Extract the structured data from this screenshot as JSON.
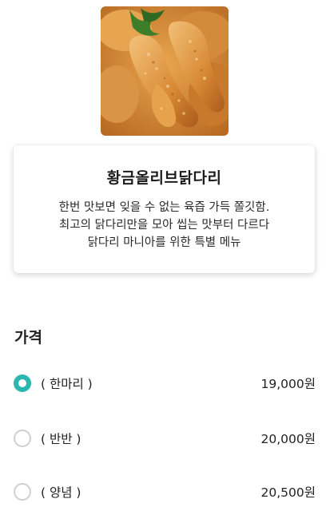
{
  "product": {
    "image_icon": "fried-chicken-photo",
    "name": "황금올리브닭다리",
    "description": [
      "한번 맛보면 잊을 수 없는 육즙 가득 쫄깃함.",
      "최고의 닭다리만을 모아 씹는 맛부터 다르다",
      "닭다리 마니아를 위한 특별 메뉴"
    ]
  },
  "price_section": {
    "title": "가격",
    "options": [
      {
        "label": "( 한마리 )",
        "price": "19,000원",
        "selected": true
      },
      {
        "label": "( 반반 )",
        "price": "20,000원",
        "selected": false
      },
      {
        "label": "( 양념 )",
        "price": "20,500원",
        "selected": false
      }
    ]
  },
  "colors": {
    "accent": "#2bb6b0",
    "radio_unchecked": "#cfcfcf"
  }
}
